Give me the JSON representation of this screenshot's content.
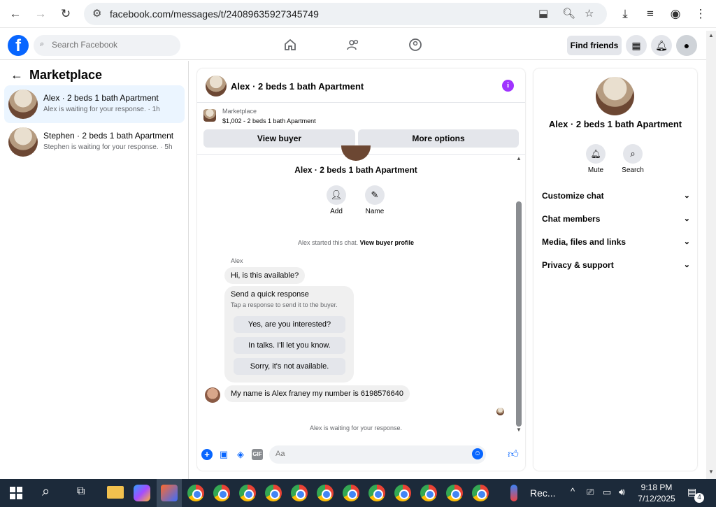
{
  "browser": {
    "url": "facebook.com/messages/t/24089635927345749"
  },
  "fb": {
    "logo": "f",
    "search_placeholder": "Search Facebook",
    "find_friends": "Find friends"
  },
  "left": {
    "title": "Marketplace",
    "conversations": [
      {
        "title": "Alex · 2 beds 1 bath Apartment",
        "sub": "Alex is waiting for your response. · 1h"
      },
      {
        "title": "Stephen · 2 beds 1 bath Apartment",
        "sub": "Stephen is waiting for your response. · 5h"
      }
    ]
  },
  "chat": {
    "header_title": "Alex · 2 beds 1 bath Apartment",
    "listing_source": "Marketplace",
    "listing_line": "$1,002 - 2 beds 1 bath Apartment",
    "view_buyer": "View buyer",
    "more_options": "More options",
    "profile_name": "Alex · 2 beds 1 bath Apartment",
    "add_label": "Add",
    "name_label": "Name",
    "started_text": "Alex started this chat.",
    "view_buyer_profile": "View buyer profile",
    "sender_name": "Alex",
    "msg1": "Hi, is this available?",
    "quick_title": "Send a quick response",
    "quick_sub": "Tap a response to send it to the buyer.",
    "quick_options": [
      "Yes, are you interested?",
      "In talks. I'll let you know.",
      "Sorry, it's not available."
    ],
    "msg2": "My name is Alex franey my number is 6198576640",
    "waiting": "Alex is waiting for your response.",
    "composer_placeholder": "Aa",
    "gif": "GIF"
  },
  "right": {
    "name": "Alex · 2 beds 1 bath Apartment",
    "mute": "Mute",
    "search": "Search",
    "sections": [
      "Customize chat",
      "Chat members",
      "Media, files and links",
      "Privacy & support"
    ]
  },
  "taskbar": {
    "time": "9:18 PM",
    "date": "7/12/2025",
    "rec_label": "Rec...",
    "notif_count": "4"
  },
  "colors": {
    "fb_blue": "#0866ff",
    "selected_conv": "#ebf5ff",
    "info_purple": "#a033ff"
  }
}
